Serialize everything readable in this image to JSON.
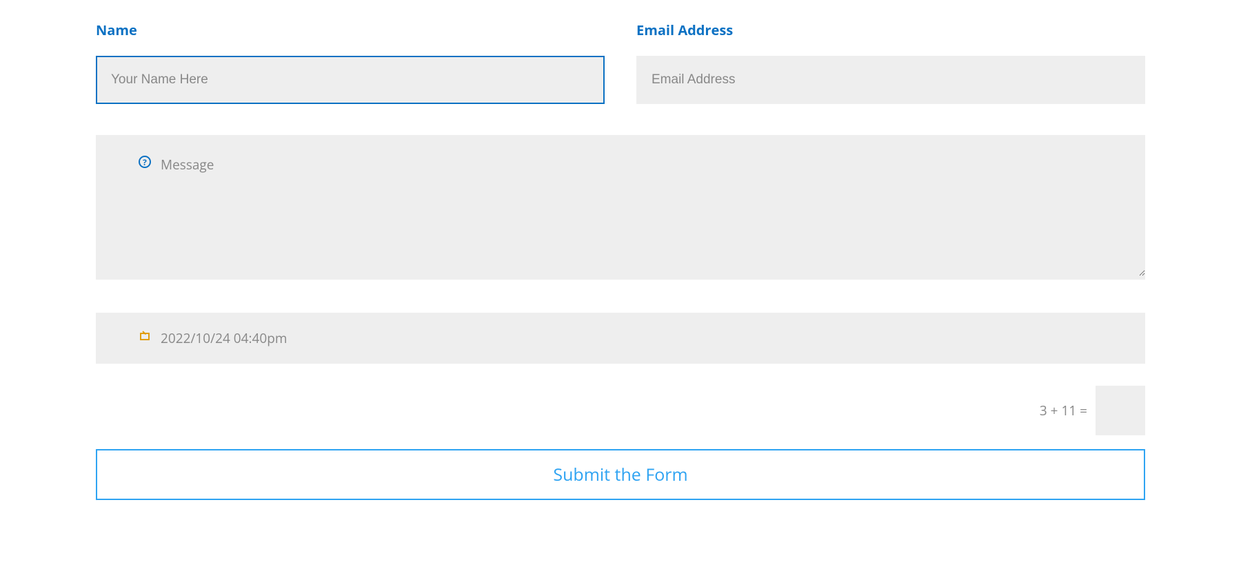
{
  "form": {
    "name": {
      "label": "Name",
      "placeholder": "Your Name Here",
      "value": ""
    },
    "email": {
      "label": "Email Address",
      "placeholder": "Email Address",
      "value": ""
    },
    "message": {
      "placeholder": "Message",
      "value": ""
    },
    "datetime": {
      "value": "2022/10/24 04:40pm"
    },
    "captcha": {
      "question": "3 + 11 =",
      "value": ""
    },
    "submit": {
      "label": "Submit the Form"
    }
  }
}
